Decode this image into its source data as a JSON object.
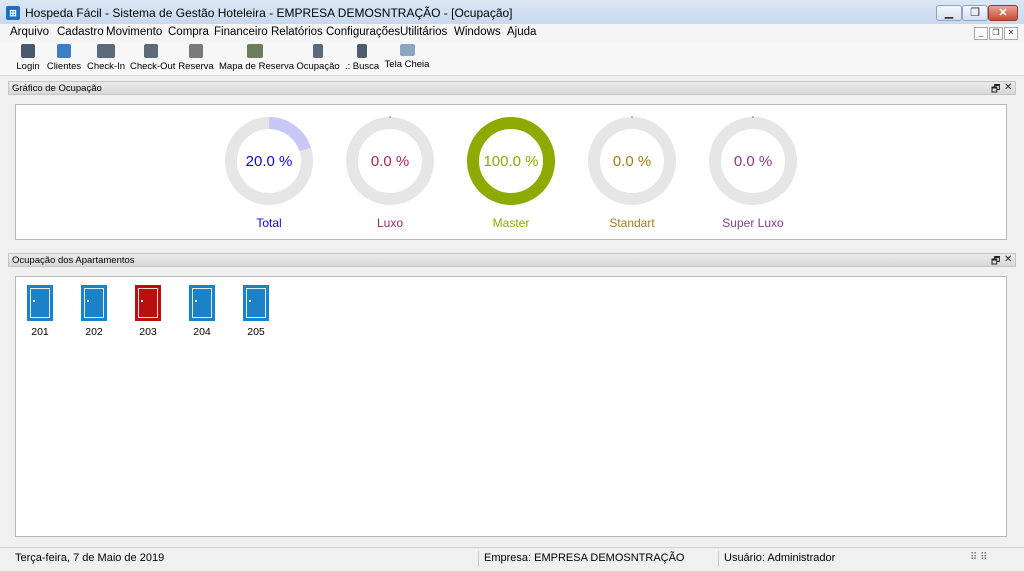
{
  "window": {
    "title": "Hospeda Fácil - Sistema de Gestão Hoteleira - EMPRESA DEMOSNTRAÇÃO - [Ocupação]",
    "icon": "hotel-app-icon",
    "minimize_icon": "minimize-icon",
    "maximize_icon": "maximize-icon",
    "close_icon": "close-icon"
  },
  "menu": {
    "items": [
      "Arquivo",
      "Cadastro",
      "Movimento",
      "Compra",
      "Financeiro",
      "Relatórios",
      "Configurações",
      "Utilitários",
      "Windows",
      "Ajuda"
    ]
  },
  "toolbar": {
    "buttons": [
      {
        "label": "Login",
        "icon": "user-login-icon",
        "color": "#4a5a6e"
      },
      {
        "label": "Clientes",
        "icon": "clients-icon",
        "color": "#3b7fc4"
      },
      {
        "label": "Check-In",
        "icon": "check-in-icon",
        "color": "#5c6b7a"
      },
      {
        "label": "Check-Out",
        "icon": "check-out-icon",
        "color": "#5c6b7a"
      },
      {
        "label": "Reserva",
        "icon": "calendar-icon",
        "color": "#7a7a7a"
      },
      {
        "label": "Mapa de Reserva",
        "icon": "map-icon",
        "color": "#6a7f5a"
      },
      {
        "label": "Ocupação",
        "icon": "building-icon",
        "color": "#5a6a7e"
      },
      {
        "label": ".: Busca",
        "icon": "search-icon",
        "color": "#4e5c6c"
      },
      {
        "label": "Tela Cheia",
        "icon": "fullscreen-icon",
        "color": "#8aa6c2"
      }
    ]
  },
  "occupancy_chart": {
    "title": "Gráfico de Ocupação",
    "gauges": [
      {
        "value_text": "20.0 %",
        "label": "Total",
        "percent": 20,
        "color": "#0a0adc",
        "ring_color": "#c8c8f8"
      },
      {
        "value_text": "0.0 %",
        "label": "Luxo",
        "percent": 0,
        "color": "#a3265f",
        "ring_color": "#a3265f"
      },
      {
        "value_text": "100.0 %",
        "label": "Master",
        "percent": 100,
        "color": "#8caa00",
        "ring_color": "#8caa00"
      },
      {
        "value_text": "0.0 %",
        "label": "Standart",
        "percent": 0,
        "color": "#a07a1e",
        "ring_color": "#a07a1e"
      },
      {
        "value_text": "0.0 %",
        "label": "Super Luxo",
        "percent": 0,
        "color": "#8a3a8a",
        "ring_color": "#8a3a8a"
      }
    ]
  },
  "rooms_panel": {
    "title": "Ocupação dos Apartamentos",
    "rooms": [
      {
        "number": "201",
        "status": "free",
        "color": "#1b82c8"
      },
      {
        "number": "202",
        "status": "free",
        "color": "#1b82c8"
      },
      {
        "number": "203",
        "status": "occupied",
        "color": "#b80f0f"
      },
      {
        "number": "204",
        "status": "free",
        "color": "#1b82c8"
      },
      {
        "number": "205",
        "status": "free",
        "color": "#1b82c8"
      }
    ]
  },
  "status": {
    "date": "Terça-feira, 7 de Maio de 2019",
    "company": "Empresa: EMPRESA DEMOSNTRAÇÃO",
    "user": "Usuário: Administrador"
  }
}
